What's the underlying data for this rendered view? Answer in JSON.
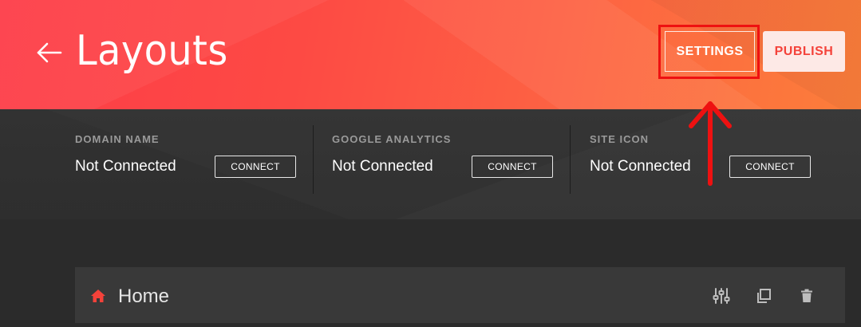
{
  "header": {
    "title": "Layouts",
    "settings_label": "SETTINGS",
    "publish_label": "PUBLISH",
    "back_icon": "arrow-left-icon",
    "colors": {
      "gradient_start": "#fd3c48",
      "gradient_end": "#fc7e3a",
      "publish_text": "#f4423a"
    }
  },
  "status": {
    "items": [
      {
        "label": "DOMAIN NAME",
        "value": "Not Connected",
        "action": "CONNECT"
      },
      {
        "label": "GOOGLE ANALYTICS",
        "value": "Not Connected",
        "action": "CONNECT"
      },
      {
        "label": "SITE ICON",
        "value": "Not Connected",
        "action": "CONNECT"
      }
    ]
  },
  "annotation": {
    "highlight_color": "#ee1111",
    "arrow_icon": "arrow-up-icon"
  },
  "pages": {
    "items": [
      {
        "title": "Home",
        "icon": "home-icon",
        "icon_color": "#f4423a",
        "tools": [
          "sliders-icon",
          "duplicate-icon",
          "trash-icon"
        ]
      }
    ]
  }
}
